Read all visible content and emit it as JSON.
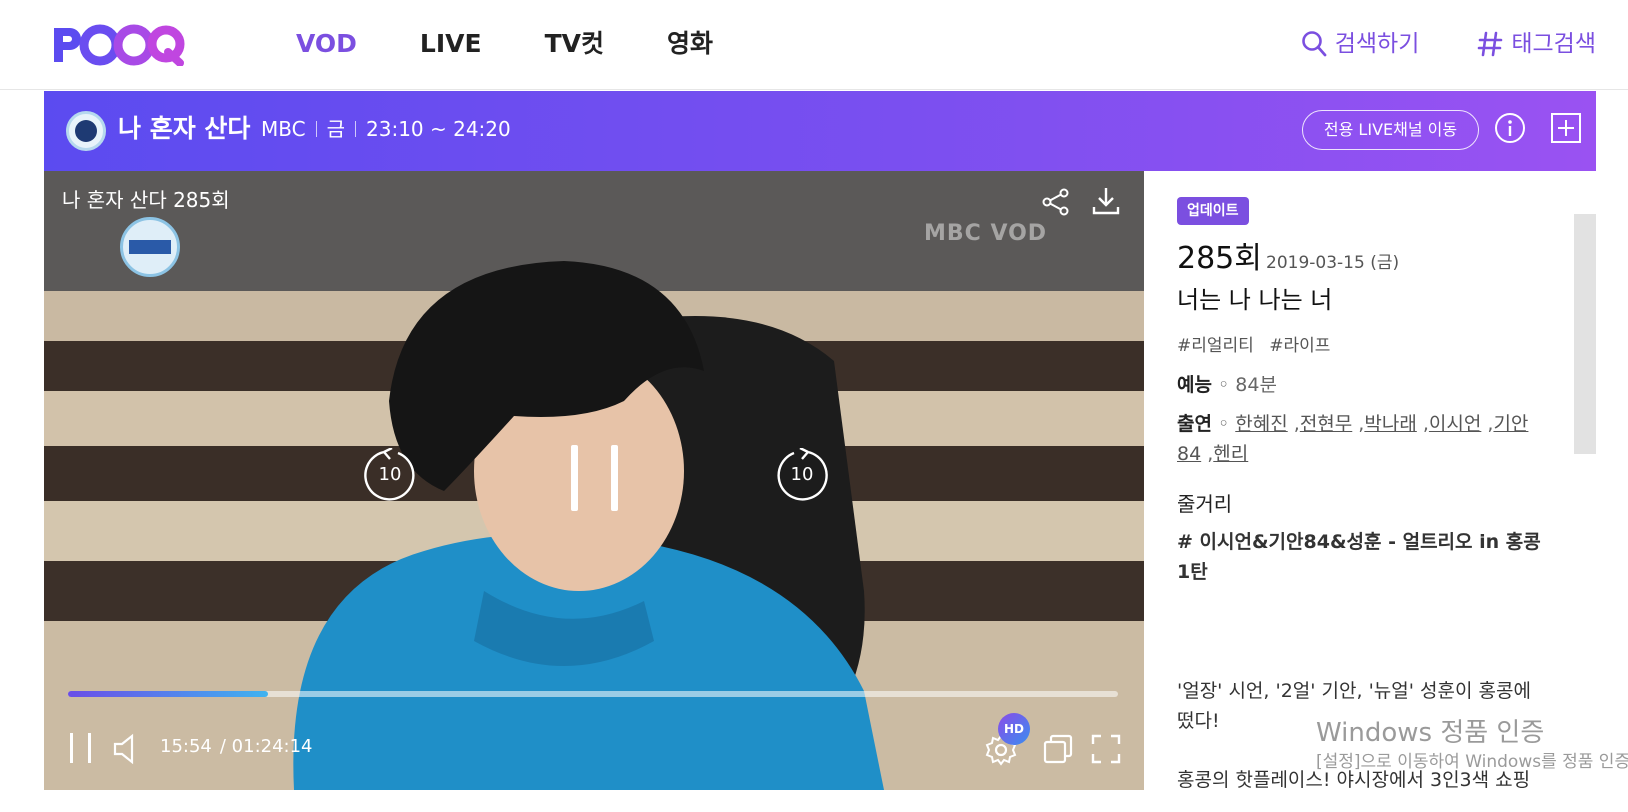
{
  "logo": {
    "text": "POOQ",
    "brand_color": "#7b4fe0"
  },
  "nav": {
    "items": [
      {
        "label": "VOD",
        "active": true
      },
      {
        "label": "LIVE",
        "active": false
      },
      {
        "label": "TV컷",
        "active": false
      },
      {
        "label": "영화",
        "active": false
      }
    ],
    "search_label": "검색하기",
    "tag_search_label": "태그검색"
  },
  "banner": {
    "program_title": "나 혼자 산다",
    "channel": "MBC",
    "day": "금",
    "time": "23:10 ~ 24:20",
    "live_button": "전용 LIVE채널 이동",
    "info_icon": "info-icon",
    "add_icon": "add-icon"
  },
  "player": {
    "episode_title": "나 혼자 산다 285회",
    "watermark": "MBC VOD",
    "rewind_seconds": "10",
    "forward_seconds": "10",
    "current_time": "15:54",
    "total_time": "/ 01:24:14",
    "progress_fraction": 0.19,
    "quality_badge": "HD",
    "program_logo_text": "나 혼자 산다"
  },
  "info": {
    "update_badge": "업데이트",
    "episode": "285회",
    "date": "2019-03-15 (금)",
    "subtitle": "너는 나 나는 너",
    "hashtags": [
      "#리얼리티",
      "#라이프"
    ],
    "genre_label": "예능",
    "duration": "84분",
    "cast_label": "출연",
    "cast": [
      "한혜진",
      "전현무",
      "박나래",
      "이시언",
      "기안84",
      "헨리"
    ],
    "synopsis_label": "줄거리",
    "synopsis_headline": "# 이시언&기안84&성훈 - 얼트리오 in 홍콩 1탄",
    "synopsis_para1": "'얼장' 시언, '2얼' 기안, '뉴얼' 성훈이 홍콩에 떴다!",
    "synopsis_para2": "홍콩의 핫플레이스! 야시장에서 3인3색 쇼핑"
  },
  "os_watermark": {
    "line1": "Windows 정품 인증",
    "line2": "[설정]으로 이동하여 Windows를 정품 인증합니다."
  }
}
